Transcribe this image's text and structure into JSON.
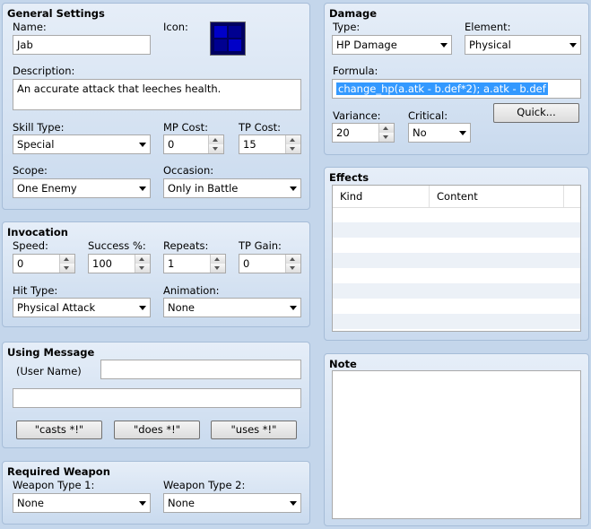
{
  "general": {
    "title": "General Settings",
    "name_label": "Name:",
    "name_value": "Jab",
    "icon_label": "Icon:",
    "description_label": "Description:",
    "description_value": "An accurate attack that leeches health.",
    "skill_type_label": "Skill Type:",
    "skill_type_value": "Special",
    "mp_cost_label": "MP Cost:",
    "mp_cost_value": "0",
    "tp_cost_label": "TP Cost:",
    "tp_cost_value": "15",
    "scope_label": "Scope:",
    "scope_value": "One Enemy",
    "occasion_label": "Occasion:",
    "occasion_value": "Only in Battle"
  },
  "invocation": {
    "title": "Invocation",
    "speed_label": "Speed:",
    "speed_value": "0",
    "success_label": "Success %:",
    "success_value": "100",
    "repeats_label": "Repeats:",
    "repeats_value": "1",
    "tp_gain_label": "TP Gain:",
    "tp_gain_value": "0",
    "hit_type_label": "Hit Type:",
    "hit_type_value": "Physical Attack",
    "animation_label": "Animation:",
    "animation_value": "None"
  },
  "using_message": {
    "title": "Using Message",
    "user_name_label": "(User Name)",
    "line1_value": "",
    "line2_value": "",
    "btn_casts": "\"casts *!\"",
    "btn_does": "\"does *!\"",
    "btn_uses": "\"uses *!\""
  },
  "required_weapon": {
    "title": "Required Weapon",
    "type1_label": "Weapon Type 1:",
    "type1_value": "None",
    "type2_label": "Weapon Type 2:",
    "type2_value": "None"
  },
  "damage": {
    "title": "Damage",
    "type_label": "Type:",
    "type_value": "HP Damage",
    "element_label": "Element:",
    "element_value": "Physical",
    "formula_label": "Formula:",
    "formula_value": "change_hp(a.atk - b.def*2); a.atk - b.def",
    "variance_label": "Variance:",
    "variance_value": "20",
    "critical_label": "Critical:",
    "critical_value": "No",
    "quick_button": "Quick..."
  },
  "effects": {
    "title": "Effects",
    "columns": [
      "Kind",
      "Content"
    ]
  },
  "note": {
    "title": "Note",
    "value": ""
  },
  "colors": {
    "background": "#c4d6eb",
    "selection": "#3399ff",
    "icon": "#0000c8"
  }
}
